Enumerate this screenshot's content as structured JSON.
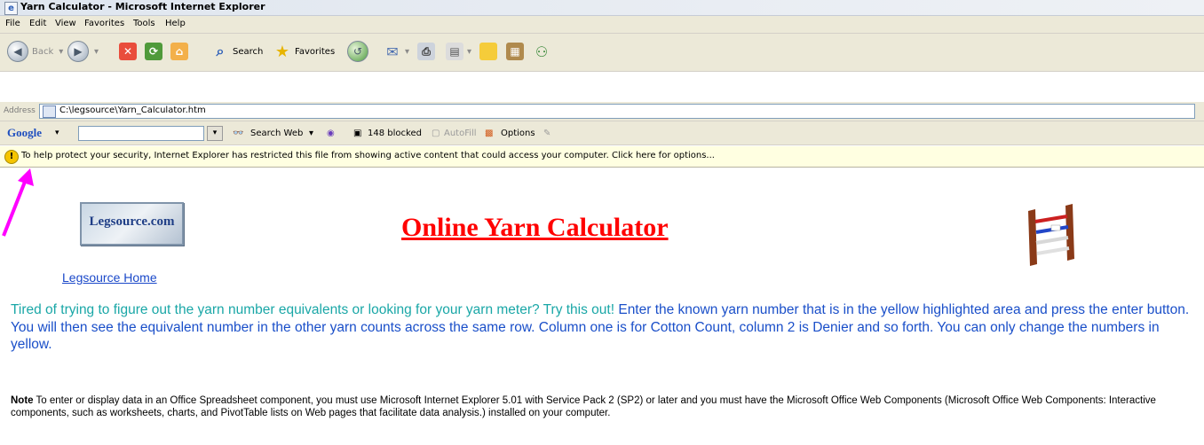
{
  "window": {
    "title": "Yarn Calculator - Microsoft Internet Explorer",
    "ie_logo": "e"
  },
  "menu": [
    "File",
    "Edit",
    "View",
    "Favorites",
    "Tools",
    "Help"
  ],
  "toolbar": {
    "back_label": "Back",
    "search_label": "Search",
    "favorites_label": "Favorites"
  },
  "address": {
    "label": "Address",
    "url": "C:\\legsource\\Yarn_Calculator.htm"
  },
  "google": {
    "brand": "Google",
    "search_web": "Search Web",
    "blocked": "148 blocked",
    "autofill": "AutoFill",
    "options": "Options"
  },
  "infobar": {
    "message": "To help protect your security, Internet Explorer has restricted this file from showing active content that could access your computer. Click here for options..."
  },
  "page": {
    "logo_text": "Legsource.com",
    "home_link": "Legsource Home",
    "title": "Online Yarn Calculator",
    "intro_teal": "Tired of trying to figure out the yarn number equivalents or looking for your yarn meter? Try this out!",
    "intro_blue": " Enter the known yarn number that is in the yellow highlighted area and press the enter button. You will then see the equivalent number in the other yarn counts across the same row. Column one is for Cotton Count, column 2 is Denier and so forth.  You can only change the numbers in yellow.",
    "note_label": "Note",
    "note_text": " To enter or display data in an Office Spreadsheet component, you must use Microsoft Internet Explorer 5.01 with Service Pack 2 (SP2) or later and you must have the Microsoft Office Web Components (Microsoft Office Web Components: Interactive components, such as worksheets, charts, and PivotTable lists on Web pages that facilitate data analysis.) installed on your computer."
  }
}
